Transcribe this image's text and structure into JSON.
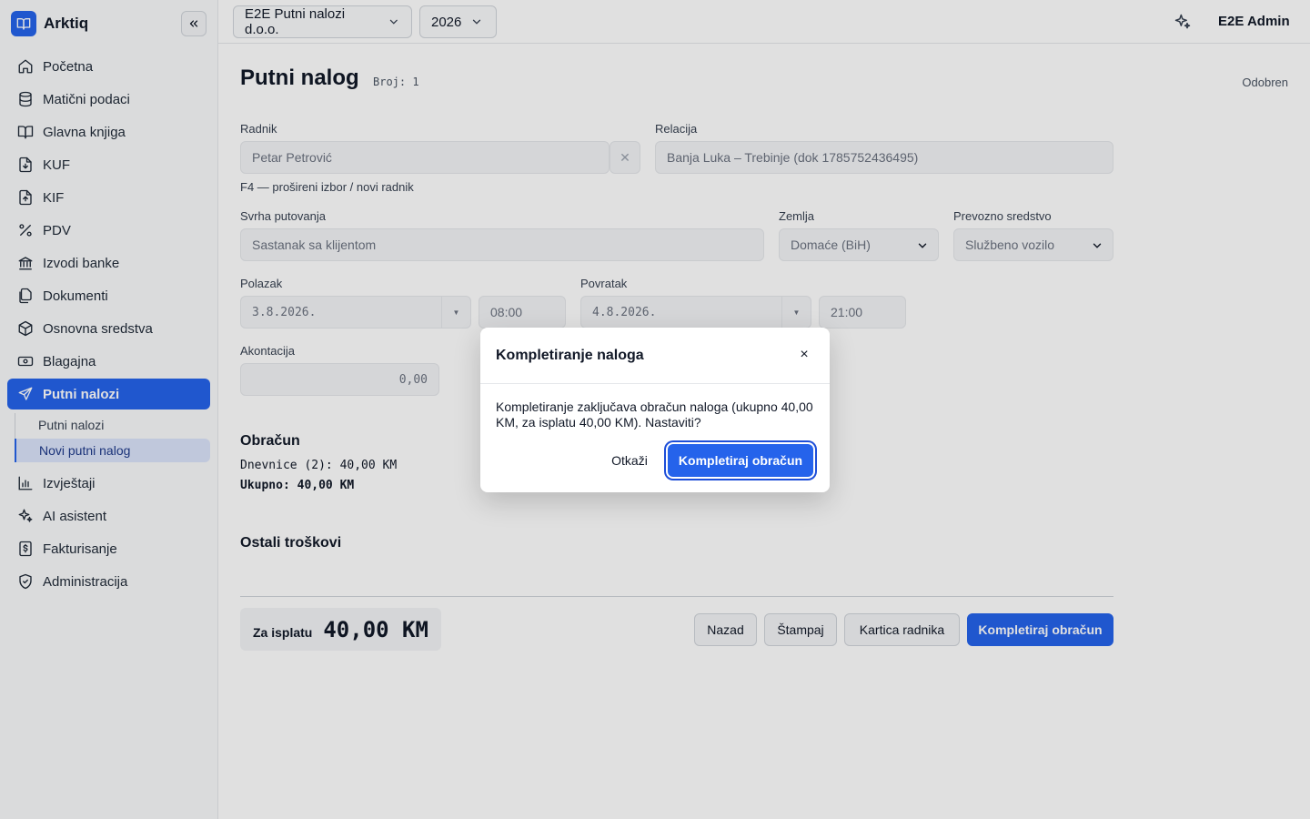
{
  "app": {
    "name": "Arktiq"
  },
  "sidebar": {
    "items": [
      {
        "label": "Početna"
      },
      {
        "label": "Matični podaci"
      },
      {
        "label": "Glavna knjiga"
      },
      {
        "label": "KUF"
      },
      {
        "label": "KIF"
      },
      {
        "label": "PDV"
      },
      {
        "label": "Izvodi banke"
      },
      {
        "label": "Dokumenti"
      },
      {
        "label": "Osnovna sredstva"
      },
      {
        "label": "Blagajna"
      },
      {
        "label": "Putni nalozi"
      },
      {
        "label": "Izvještaji"
      },
      {
        "label": "AI asistent"
      },
      {
        "label": "Fakturisanje"
      },
      {
        "label": "Administracija"
      }
    ],
    "sub_items": [
      {
        "label": "Putni nalozi"
      },
      {
        "label": "Novi putni nalog"
      }
    ]
  },
  "topbar": {
    "company": "E2E Putni nalozi d.o.o.",
    "year": "2026",
    "user": "E2E Admin"
  },
  "page": {
    "title": "Putni nalog",
    "number": "Broj: 1",
    "status": "Odobren"
  },
  "form": {
    "worker": {
      "label": "Radnik",
      "value": "Petar Petrović",
      "hint": "F4 — prošireni izbor / novi radnik"
    },
    "relation": {
      "label": "Relacija",
      "value": "Banja Luka – Trebinje (dok 1785752436495)"
    },
    "purpose": {
      "label": "Svrha putovanja",
      "value": "Sastanak sa klijentom"
    },
    "country": {
      "label": "Zemlja",
      "value": "Domaće (BiH)"
    },
    "transport": {
      "label": "Prevozno sredstvo",
      "value": "Službeno vozilo"
    },
    "departure": {
      "label": "Polazak",
      "date": "3.8.2026.",
      "time": "08:00"
    },
    "return": {
      "label": "Povratak",
      "date": "4.8.2026.",
      "time": "21:00"
    },
    "advance": {
      "label": "Akontacija",
      "value": "0,00"
    }
  },
  "calc": {
    "title": "Obračun",
    "per_diem": "Dnevnice (2): 40,00 KM",
    "total": "Ukupno: 40,00 KM"
  },
  "other_costs": {
    "title": "Ostali troškovi"
  },
  "footer": {
    "payout_label": "Za isplatu",
    "payout_value": "40,00 KM",
    "buttons": {
      "back": "Nazad",
      "print": "Štampaj",
      "worker_card": "Kartica radnika",
      "complete": "Kompletiraj obračun"
    }
  },
  "dialog": {
    "title": "Kompletiranje naloga",
    "message": "Kompletiranje zaključava obračun naloga (ukupno 40,00 KM, za isplatu 40,00 KM). Nastaviti?",
    "cancel": "Otkaži",
    "confirm": "Kompletiraj obračun"
  },
  "colors": {
    "accent": "#2563eb",
    "sidebar_bg": "#f9fafb"
  }
}
